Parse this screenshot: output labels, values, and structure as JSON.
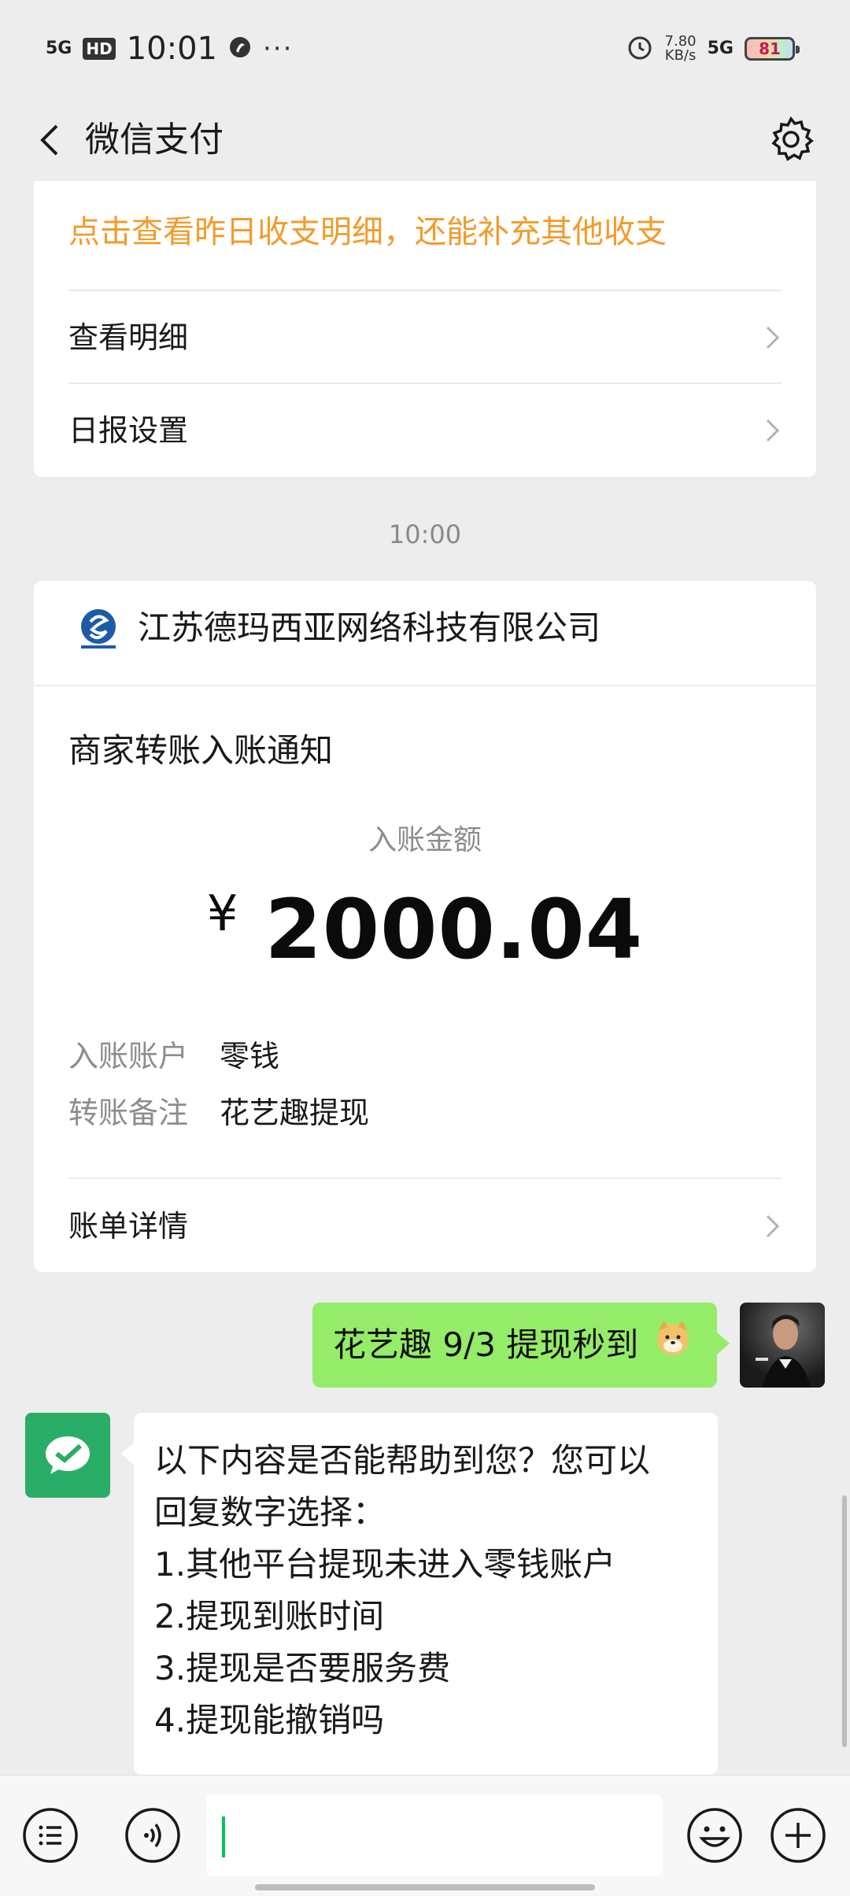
{
  "status_bar": {
    "network": "5G",
    "hd": "HD",
    "time": "10:01",
    "dots": "···",
    "speed_value": "7.80",
    "speed_unit": "KB/s",
    "network2": "5G",
    "battery": "81"
  },
  "nav": {
    "title": "微信支付"
  },
  "daily_report": {
    "prompt": "点击查看昨日收支明细，还能补充其他收支",
    "rows": [
      {
        "label": "查看明细"
      },
      {
        "label": "日报设置"
      }
    ]
  },
  "timestamp": "10:00",
  "transfer_card": {
    "company": "江苏德玛西亚网络科技有限公司",
    "notice_title": "商家转账入账通知",
    "amount_label": "入账金额",
    "currency": "¥",
    "amount": "2000.04",
    "details": [
      {
        "key": "入账账户",
        "value": "零钱"
      },
      {
        "key": "转账备注",
        "value": "花艺趣提现"
      }
    ],
    "bill_detail_label": "账单详情"
  },
  "chat": {
    "my_message": "花艺趣 9/3 提现秒到",
    "reply_lines": [
      "以下内容是否能帮助到您？您可以",
      "回复数字选择：",
      "1.其他平台提现未进入零钱账户",
      "2.提现到账时间",
      "3.提现是否要服务费",
      "4.提现能撤销吗"
    ]
  },
  "colors": {
    "wechat_green": "#07c160",
    "bubble_green": "#95ec69",
    "orange": "#f29b2a"
  }
}
